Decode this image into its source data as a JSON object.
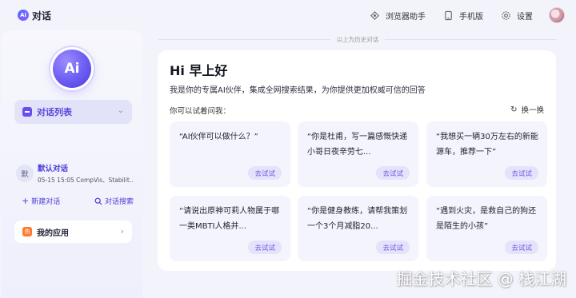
{
  "brand": {
    "logo_text": "Ai",
    "name": "对话"
  },
  "top_actions": [
    {
      "icon": "browser-extension-icon",
      "label": "浏览器助手"
    },
    {
      "icon": "mobile-icon",
      "label": "手机版"
    },
    {
      "icon": "gear-icon",
      "label": "设置"
    }
  ],
  "sidebar": {
    "logo_text": "Ai",
    "conv_list_label": "对话列表",
    "conversation": {
      "badge": "默",
      "title": "默认对话",
      "meta": "05-15 15:05   CompVis、Stabilit..."
    },
    "new_conv_label": "新建对话",
    "search_conv_label": "对话搜索",
    "my_apps_badge": "热",
    "my_apps_label": "我的应用"
  },
  "main": {
    "history_label": "以上为历史对话",
    "greeting": "Hi 早上好",
    "intro": "我是你的专属AI伙伴，集成全网搜索结果，为你提供更加权威可信的回答",
    "try_ask_label": "你可以试着问我：",
    "refresh_label": "换一换",
    "prompts": [
      {
        "text": "“AI伙伴可以做什么？”",
        "button": "去试试"
      },
      {
        "text": "“你是杜甫，写一篇感慨快递小哥日夜辛劳七...",
        "button": "去试试"
      },
      {
        "text": "“我想买一辆30万左右的新能源车，推荐一下”",
        "button": "去试试"
      },
      {
        "text": "“请说出原神可莉人物属于哪一类MBTI人格并...",
        "button": "去试试"
      },
      {
        "text": "“你是健身教练，请帮我策划一个3个月减脂20...",
        "button": "去试试"
      },
      {
        "text": "“遇到火灾，是救自己的狗还是陌生的小孩”",
        "button": "去试试"
      }
    ]
  },
  "watermark": "掘金技术社区 @ 栈江湖",
  "colors": {
    "accent": "#5a46e0",
    "background": "#f3f4fb",
    "card": "#ffffff"
  }
}
